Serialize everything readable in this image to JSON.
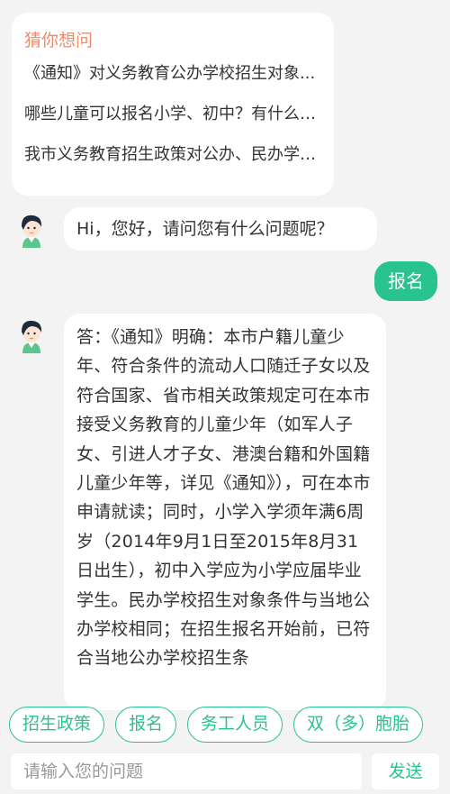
{
  "guess": {
    "title": "猜你想问",
    "items": [
      "《通知》对义务教育公办学校招生对象...",
      "哪些儿童可以报名小学、初中？有什么条件？",
      "我市义务教育招生政策对公办、民办学校..."
    ]
  },
  "chat": {
    "greeting": "Hi，您好，请问您有什么问题呢？",
    "user_message": "报名",
    "answer": "答：《通知》明确：本市户籍儿童少年、符合条件的流动人口随迁子女以及符合国家、省市相关政策规定可在本市接受义务教育的儿童少年（如军人子女、引进人才子女、港澳台籍和外国籍儿童少年等，详见《通知》），可在本市申请就读；同时，小学入学须年满6周岁（2014年9月1日至2015年8月31日出生），初中入学应为小学应届毕业学生。民办学校招生对象条件与当地公办学校相同；在招生报名开始前，已符合当地公办学校招生条"
  },
  "quick_replies": [
    "招生政策",
    "报名",
    "务工人员",
    "双（多）胞胎"
  ],
  "input": {
    "placeholder": "请输入您的问题",
    "send_label": "发送"
  },
  "colors": {
    "accent": "#29c38f",
    "guess_title": "#f08a6a",
    "background": "#f3f3f3"
  }
}
